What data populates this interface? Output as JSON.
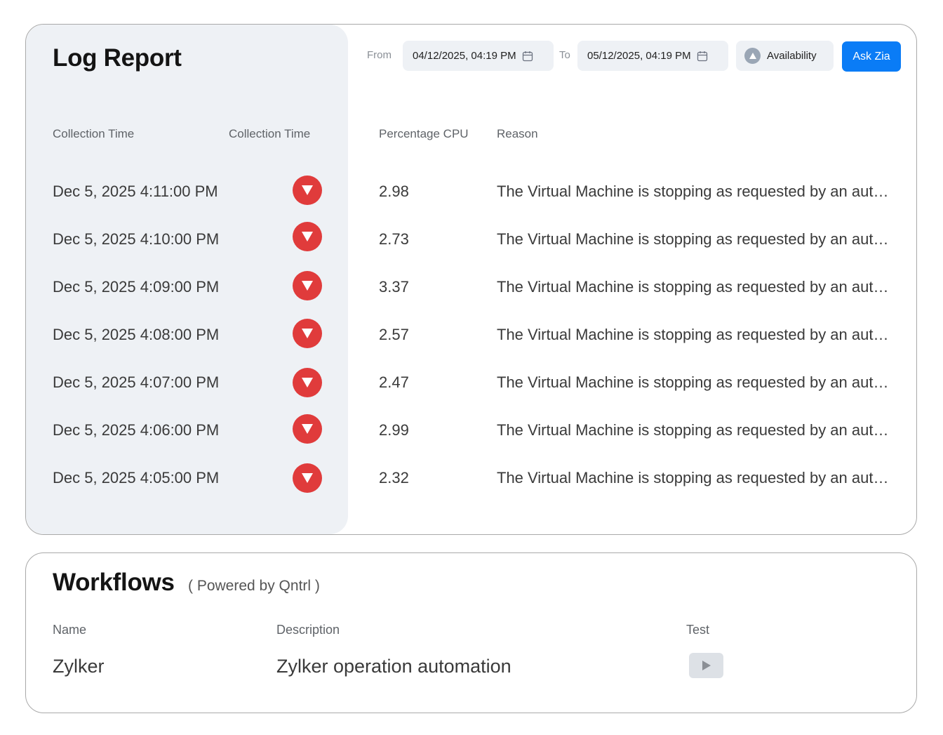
{
  "log_report": {
    "title": "Log Report",
    "toolbar": {
      "from_label": "From",
      "from_value": "04/12/2025, 04:19 PM",
      "to_label": "To",
      "to_value": "05/12/2025, 04:19 PM",
      "availability_label": "Availability",
      "ask_zia_label": "Ask Zia"
    },
    "columns": {
      "collection_time": "Collection Time",
      "status": "Collection Time",
      "percentage_cpu": "Percentage CPU",
      "reason": "Reason"
    },
    "rows": [
      {
        "time": "Dec 5, 2025 4:11:00 PM",
        "cpu": "2.98",
        "reason": "The Virtual Machine is stopping as requested by an authorized user or process"
      },
      {
        "time": "Dec 5, 2025 4:10:00 PM",
        "cpu": "2.73",
        "reason": "The Virtual Machine is stopping as requested by an authorized user or process"
      },
      {
        "time": "Dec 5, 2025 4:09:00 PM",
        "cpu": "3.37",
        "reason": "The Virtual Machine is stopping as requested by an authorized user or process"
      },
      {
        "time": "Dec 5, 2025 4:08:00 PM",
        "cpu": "2.57",
        "reason": "The Virtual Machine is stopping as requested by an authorized user or process"
      },
      {
        "time": "Dec 5, 2025 4:07:00 PM",
        "cpu": "2.47",
        "reason": "The Virtual Machine is stopping as requested by an authorized user or process"
      },
      {
        "time": "Dec 5, 2025 4:06:00 PM",
        "cpu": "2.99",
        "reason": "The Virtual Machine is stopping as requested by an authorized user or process"
      },
      {
        "time": "Dec 5, 2025 4:05:00 PM",
        "cpu": "2.32",
        "reason": "The Virtual Machine is stopping as requested by an authorized user or process"
      }
    ],
    "status_icon": "down-status-icon",
    "colors": {
      "status_down": "#e03b3b",
      "accent": "#0a7cf6",
      "panel": "#eef1f5"
    }
  },
  "workflows": {
    "title": "Workflows",
    "subtitle": "( Powered by Qntrl )",
    "columns": {
      "name": "Name",
      "description": "Description",
      "test": "Test"
    },
    "rows": [
      {
        "name": "Zylker",
        "description": "Zylker operation automation"
      }
    ],
    "test_icon": "play-icon"
  }
}
